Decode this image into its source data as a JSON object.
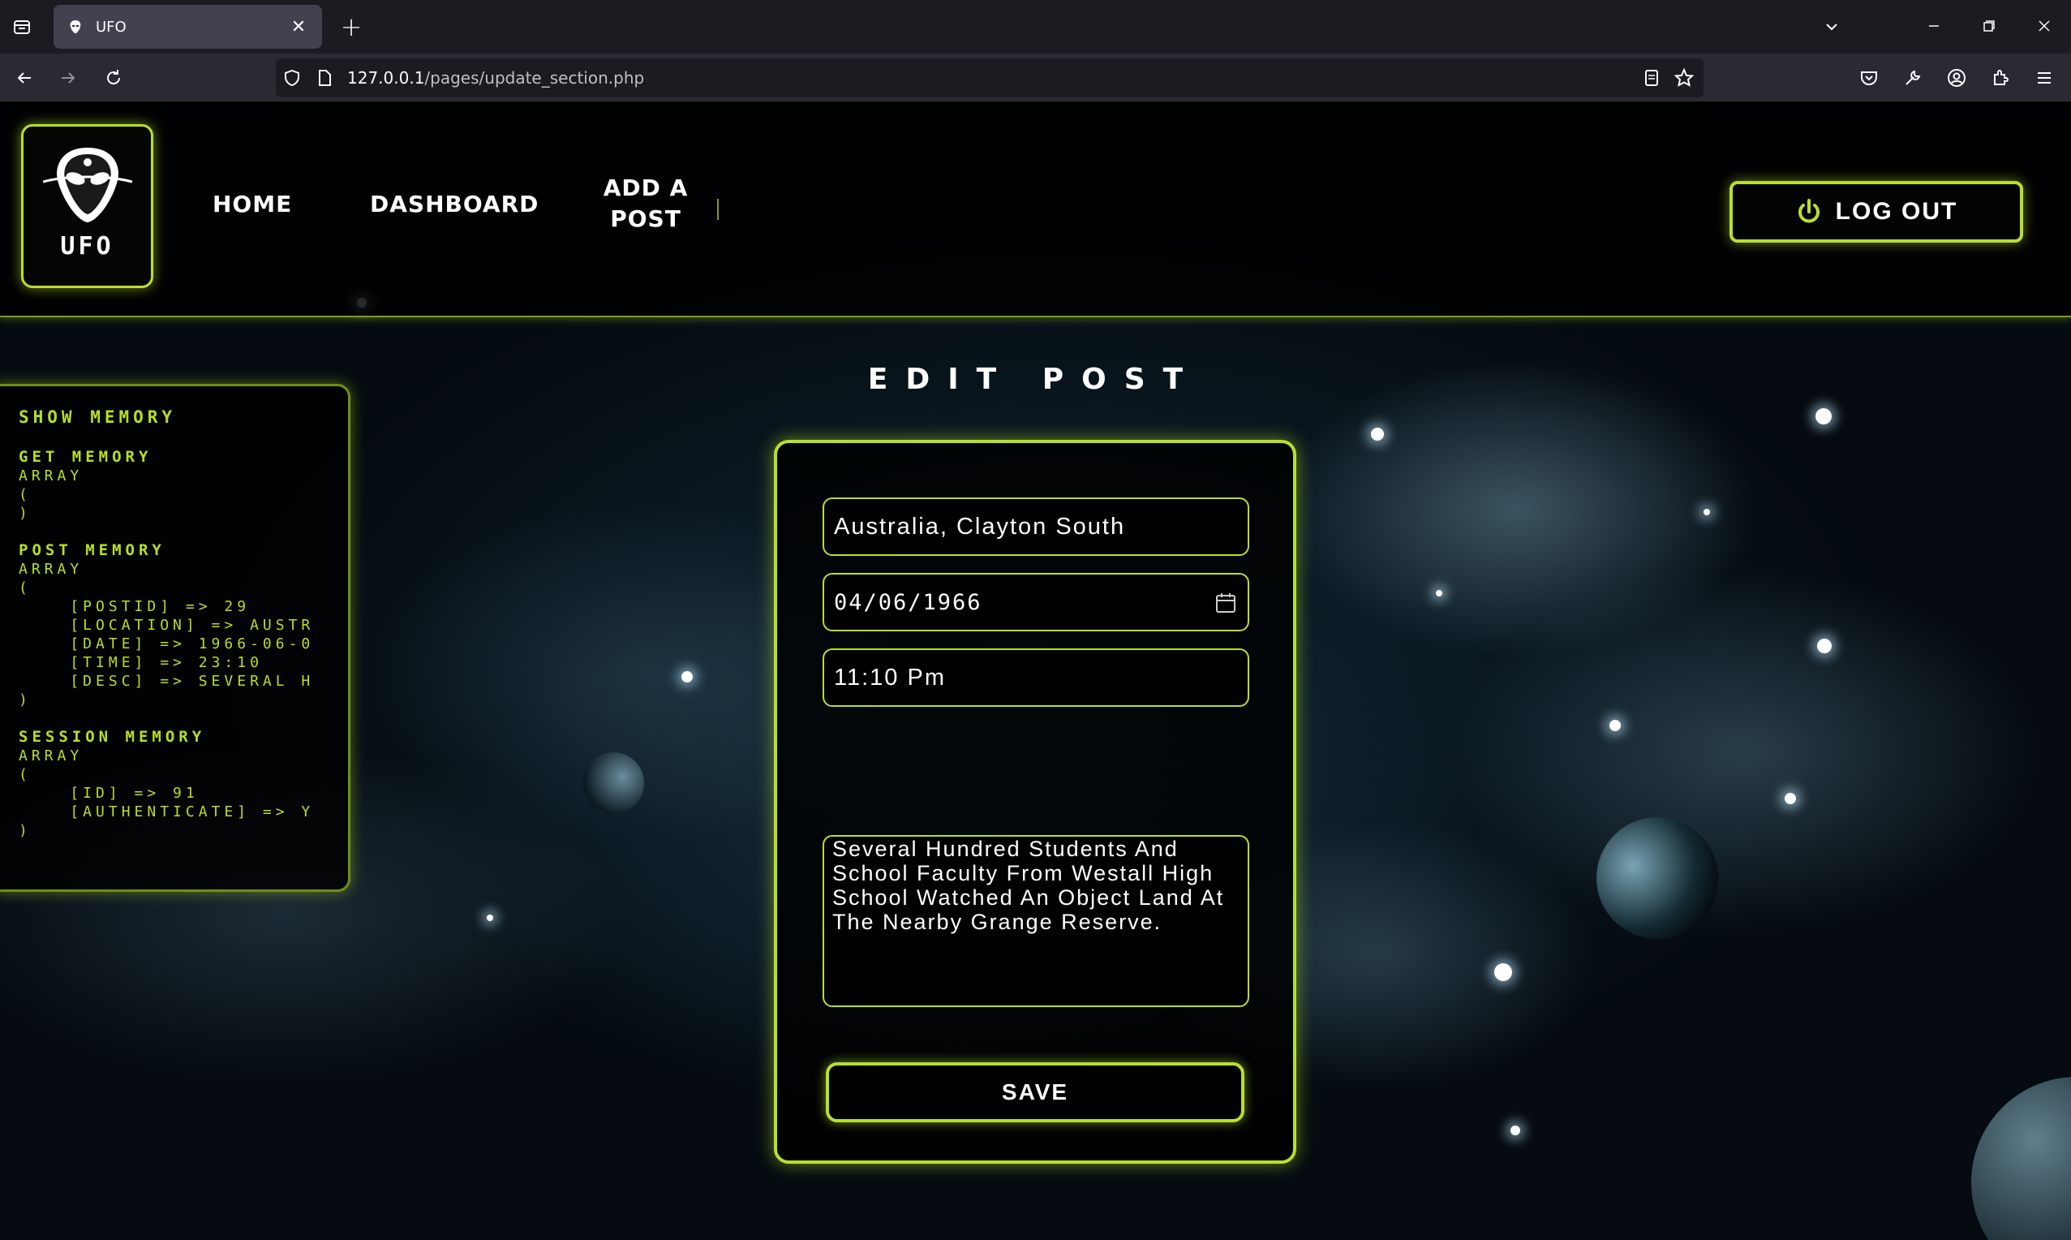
{
  "browser": {
    "tab_title": "UFO",
    "url_host": "127.0.0.1",
    "url_path": "/pages/update_section.php"
  },
  "header": {
    "logo_text": "UFO",
    "nav": [
      {
        "label": "Home"
      },
      {
        "label": "Dashboard"
      },
      {
        "label": "Add a"
      },
      {
        "label": "Post"
      }
    ],
    "logout_label": "Log out"
  },
  "debug": {
    "title": "SHOW MEMORY",
    "get_heading": "GET MEMORY",
    "get_lines": [
      "ARRAY",
      "(",
      ")"
    ],
    "post_heading": "POST MEMORY",
    "post_lines": [
      "ARRAY",
      "(",
      "    [POSTID] => 29",
      "    [LOCATION] => AUSTR",
      "    [DATE] => 1966-06-0",
      "    [TIME] => 23:10",
      "    [DESC] => SEVERAL H",
      ")"
    ],
    "session_heading": "SESSION MEMORY",
    "session_lines": [
      "ARRAY",
      "(",
      "    [ID] => 91",
      "    [AUTHENTICATE] => Y",
      ")"
    ]
  },
  "page": {
    "heading": "EDIT POST"
  },
  "form": {
    "location": "Australia, Clayton South",
    "date": "04/06/1966",
    "time": "11:10 Pm",
    "description": "Several Hundred Students And School Faculty From Westall High School Watched An Object Land At The Nearby Grange Reserve.",
    "save_label": "Save"
  },
  "colors": {
    "accent": "#b8e02a",
    "debug_text": "#b6e01f"
  }
}
